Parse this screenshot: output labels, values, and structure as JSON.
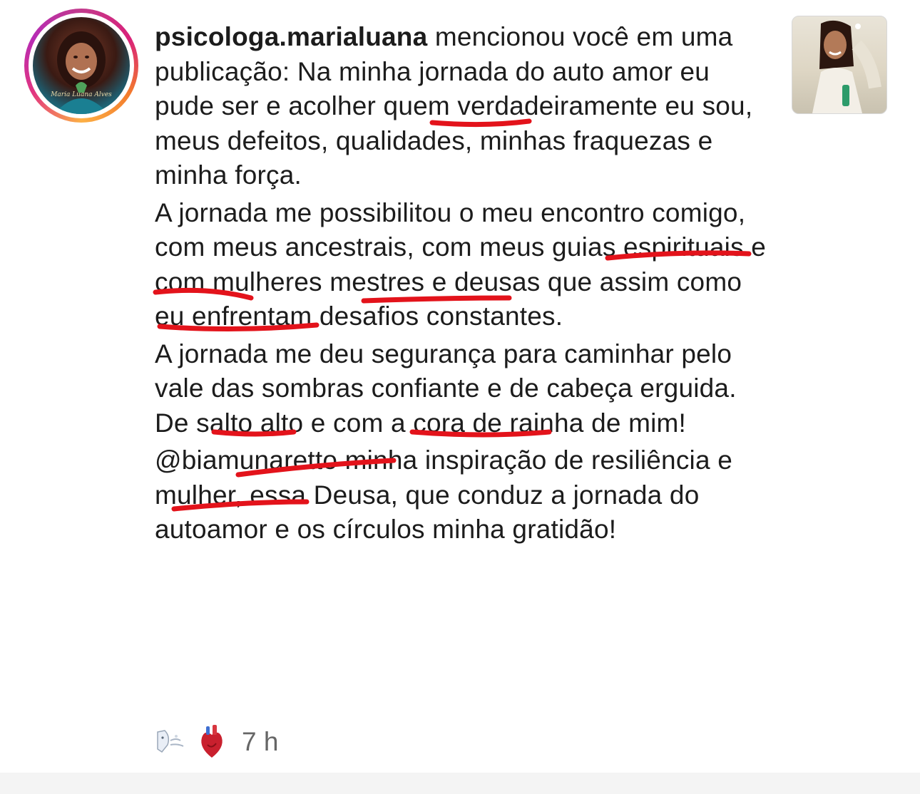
{
  "notification": {
    "username": "psicologa.marialuana",
    "intro": " mencionou você em uma publicação: ",
    "paragraphs": [
      "Na minha jornada do auto amor eu pude ser e acolher quem verdadeiramente eu sou, meus defeitos, qualidades, minhas fraquezas e minha força.",
      "A jornada me possibilitou o meu encontro comigo, com meus ancestrais, com meus guias espirituais e com mulheres mestres e deusas que assim como eu enfrentam desafios constantes.",
      "A jornada me deu segurança para caminhar pelo vale das sombras confiante e de cabeça erguida. De salto alto e com a cora de rainha de mim!",
      "@biamunaretto minha inspiração de resiliência e mulher, essa Deusa, que conduz a jornada do autoamor e os círculos minha gratidão!"
    ],
    "avatar_signature": "Maria Luana Alves",
    "time": "7 h"
  },
  "reactions": [
    {
      "icon": "wind-face-icon"
    },
    {
      "icon": "anatomical-heart-icon"
    }
  ],
  "colors": {
    "text": "#1c1c1c",
    "time": "#666666",
    "underline_marker": "#e3131b",
    "ring_start": "#c23a8c",
    "ring_end": "#fcb045"
  }
}
